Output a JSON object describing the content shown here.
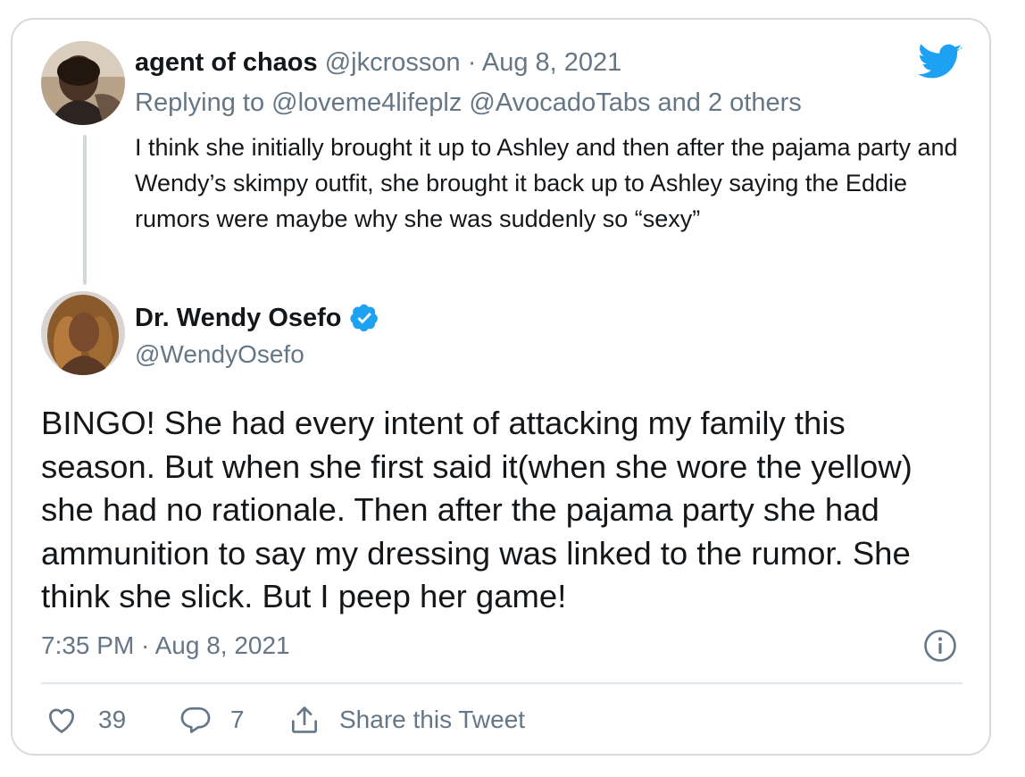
{
  "reply_tweet": {
    "author_name": "agent of chaos",
    "author_handle": "@jkcrosson",
    "separator": "·",
    "date": "Aug 8, 2021",
    "replying_prefix": "Replying to",
    "replying_mention_1": "@loveme4lifeplz",
    "replying_mention_2": "@AvocadoTabs",
    "replying_suffix": "and 2 others",
    "text": "I think she initially brought it up to Ashley and then after the pajama party and Wendy’s skimpy outfit, she brought it back up to Ashley saying the Eddie rumors were maybe why she was suddenly so “sexy”"
  },
  "main_tweet": {
    "author_name": "Dr. Wendy Osefo",
    "author_handle": "@WendyOsefo",
    "text": "BINGO! She had every intent of attacking my family this season. But when she first said it(when she wore the yellow) she had no rationale. Then after the pajama party she had ammunition to say my dressing was linked to the rumor. She think she slick. But I peep her game!",
    "timestamp": "7:35 PM · Aug 8, 2021"
  },
  "actions": {
    "like_count": "39",
    "reply_count": "7",
    "share_label": "Share this Tweet"
  },
  "icons": {
    "brand": "twitter-bird-icon",
    "verified": "verified-badge-icon",
    "info": "info-icon",
    "like": "heart-icon",
    "reply": "reply-bubble-icon",
    "share": "share-icon"
  },
  "colors": {
    "brand_blue": "#1da1f2",
    "text": "#14171a",
    "muted": "#657786",
    "border": "#d6dbe0"
  }
}
